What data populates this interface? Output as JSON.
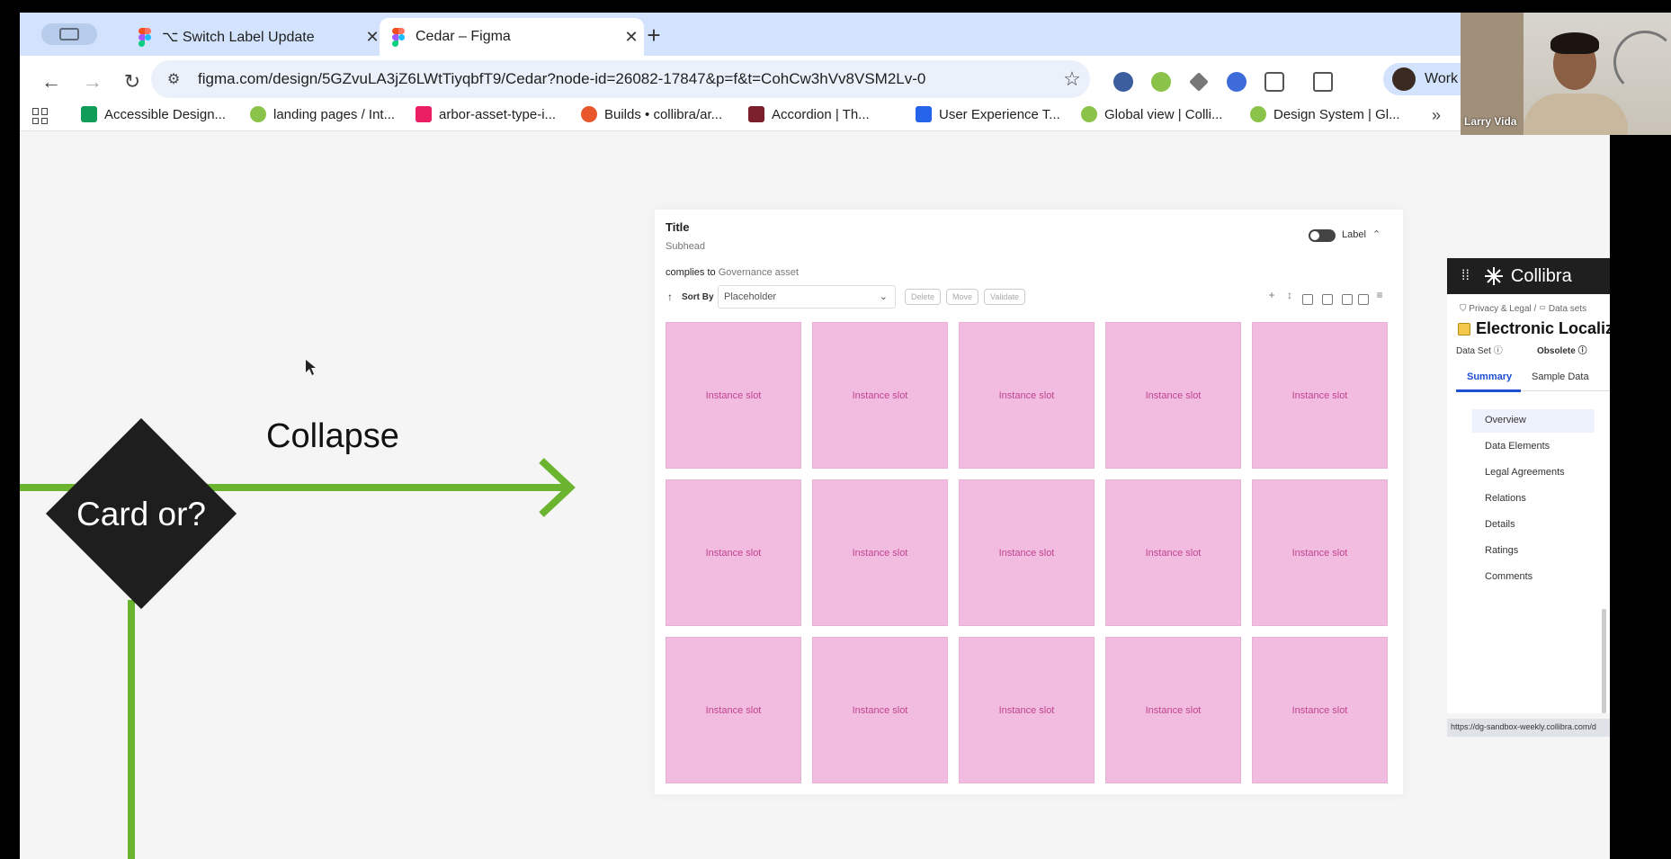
{
  "browser": {
    "tabs": [
      {
        "title": "⌥ Switch Label Update",
        "active": false
      },
      {
        "title": "Cedar – Figma",
        "active": true
      }
    ],
    "url": "figma.com/design/5GZvuLA3jZ6LWtTiyqbfT9/Cedar?node-id=26082-17847&p=f&t=CohCw3hVv8VSM2Lv-0",
    "profile_label": "Work",
    "bookmarks": [
      {
        "label": "Accessible Design...",
        "color": "#0f9d58"
      },
      {
        "label": "landing pages / Int...",
        "color": "#8bc34a"
      },
      {
        "label": "arbor-asset-type-i...",
        "color": "#e91e63"
      },
      {
        "label": "Builds • collibra/ar...",
        "color": "#e8572c"
      },
      {
        "label": "Accordion | Th...",
        "color": "#7a1f2b"
      },
      {
        "label": "User Experience T...",
        "color": "#2563eb"
      },
      {
        "label": "Global view | Colli...",
        "color": "#8bc34a"
      },
      {
        "label": "Design System | Gl...",
        "color": "#8bc34a"
      }
    ]
  },
  "canvas": {
    "flow_label": "Collapse",
    "decision_label": "Card or?",
    "frame": {
      "title": "Title",
      "subhead": "Subhead",
      "toggle_label": "Label",
      "complies_prefix": "complies to",
      "complies_target": "Governance asset",
      "sort_by": "Sort By",
      "select_placeholder": "Placeholder",
      "actions": [
        "Delete",
        "Move",
        "Validate"
      ],
      "slot_label": "Instance slot",
      "slot_count": 15
    }
  },
  "side_panel": {
    "brand": "Collibra",
    "breadcrumb": [
      "Privacy & Legal",
      "Data sets"
    ],
    "asset_title": "Electronic Localiz",
    "asset_type": "Data Set",
    "status": "Obsolete",
    "tabs": [
      "Summary",
      "Sample Data"
    ],
    "nav": [
      "Overview",
      "Data Elements",
      "Legal Agreements",
      "Relations",
      "Details",
      "Ratings",
      "Comments"
    ],
    "status_url": "https://dg-sandbox-weekly.collibra.com/d"
  },
  "video": {
    "participant_name": "Larry Vida"
  },
  "colors": {
    "accent_green": "#6bb42f",
    "slot_pink": "#f2bce0",
    "slot_text": "#c0448f",
    "collibra_blue": "#1f4fd1"
  }
}
